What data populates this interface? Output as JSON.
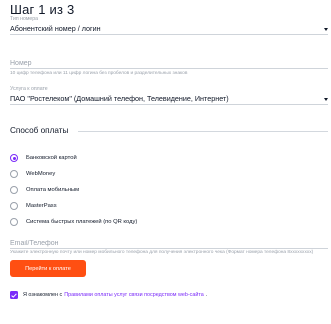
{
  "step": {
    "title": "Шаг 1 из 3"
  },
  "number_type": {
    "caption": "Тип номера",
    "value": "Абонентский номер / логин"
  },
  "number": {
    "placeholder": "Номер",
    "hint": "10 цифр телефона или 11 цифр логина без пробелов и разделительных знаков"
  },
  "service": {
    "caption": "Услуга к оплате",
    "value": "ПАО \"Ростелеком\" (Домашний телефон, Телевидение, Интернет)"
  },
  "payment": {
    "section_label": "Способ оплаты",
    "options": [
      {
        "label": "Банковской картой",
        "checked": true
      },
      {
        "label": "WebMoney",
        "checked": false
      },
      {
        "label": "Оплата мобильным",
        "checked": false
      },
      {
        "label": "MasterPass",
        "checked": false
      },
      {
        "label": "Система быстрых платежей (по QR коду)",
        "checked": false
      }
    ]
  },
  "contact": {
    "placeholder": "Email/Телефон",
    "hint": "Укажите электронную почту или номер мобильного телефона для получения электронного чека (Формат номера телефона 8ххххххххх)"
  },
  "submit_label": "Перейти к оплате",
  "agreement": {
    "checked": true,
    "prefix": "Я ознакомлен с",
    "link": "Правилами оплаты услуг связи посредством web-сайта",
    "suffix": "."
  },
  "colors": {
    "accent": "#7b2bf9",
    "button": "#ff4f12"
  }
}
